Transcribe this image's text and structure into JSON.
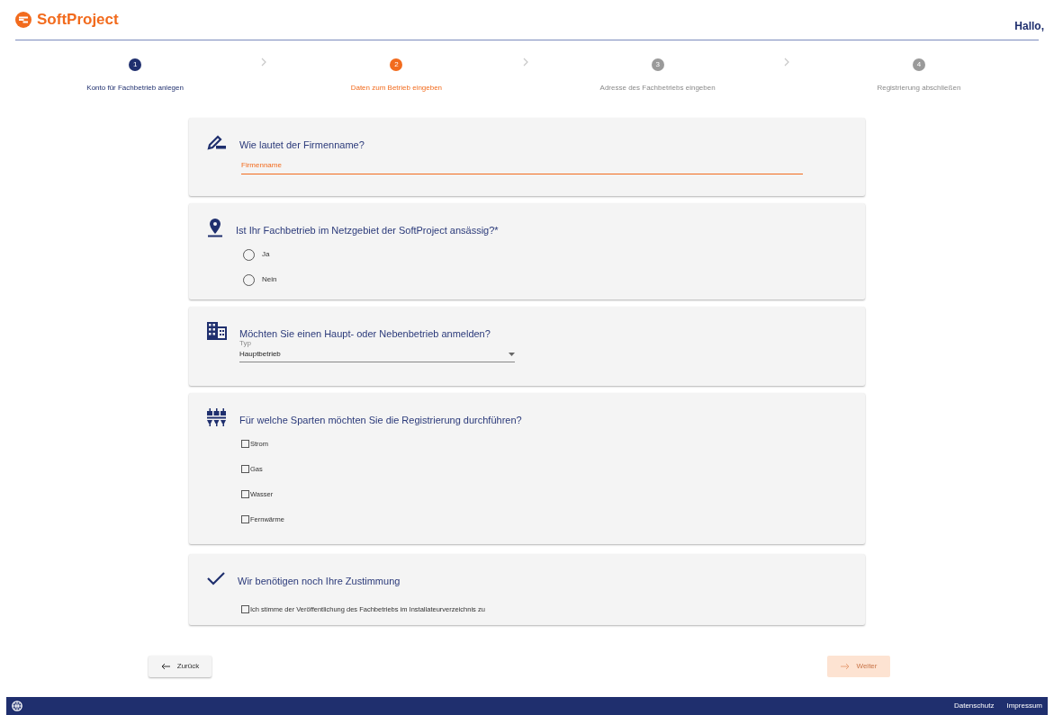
{
  "header": {
    "logo": "SoftProject",
    "greeting": "Hallo,"
  },
  "steps": [
    {
      "number": "1",
      "label": "Konto für Fachbetrieb anlegen",
      "completed": true,
      "selected": false
    },
    {
      "number": "2",
      "label": "Daten zum Betrieb eingeben",
      "completed": false,
      "selected": true
    },
    {
      "number": "3",
      "label": "Adresse des Fachbetriebs eingeben",
      "completed": false,
      "selected": false
    },
    {
      "number": "4",
      "label": "Registrierung abschließen",
      "completed": false,
      "selected": false
    }
  ],
  "sections": [
    {
      "kind": "text",
      "question": "Wie lautet der Firmenname?",
      "placeholder": "Firmenname"
    },
    {
      "kind": "radio",
      "question": "Ist Ihr Fachbetrieb im Netzgebiet der SoftProject ansässig?*",
      "options": [
        {
          "label": "Ja",
          "selected": false
        },
        {
          "label": "Nein",
          "selected": false
        }
      ]
    },
    {
      "kind": "select",
      "question": "Möchten Sie einen Haupt- oder Nebenbetrieb anmelden?",
      "field_label": "Typ",
      "value": "Hauptbetrieb"
    },
    {
      "kind": "checkbox",
      "question": "Für welche Sparten möchten Sie die Registrierung durchführen?",
      "options": [
        {
          "label": "Strom",
          "checked": false
        },
        {
          "label": "Gas",
          "checked": false
        },
        {
          "label": "Wasser",
          "checked": false
        },
        {
          "label": "Fernwärme",
          "checked": false
        }
      ]
    },
    {
      "kind": "consent",
      "question": "Wir benötigen noch Ihre Zustimmung",
      "options": [
        {
          "label": "Ich stimme der Veröffentlichung des Fachbetriebs im Installateurverzeichnis zu",
          "checked": false
        }
      ]
    }
  ],
  "buttons": {
    "back": {
      "label": "Zurück",
      "disabled": false
    },
    "next": {
      "label": "Weiter",
      "disabled": true
    }
  },
  "footer": {
    "links": [
      "Datenschutz",
      "Impressum"
    ]
  }
}
